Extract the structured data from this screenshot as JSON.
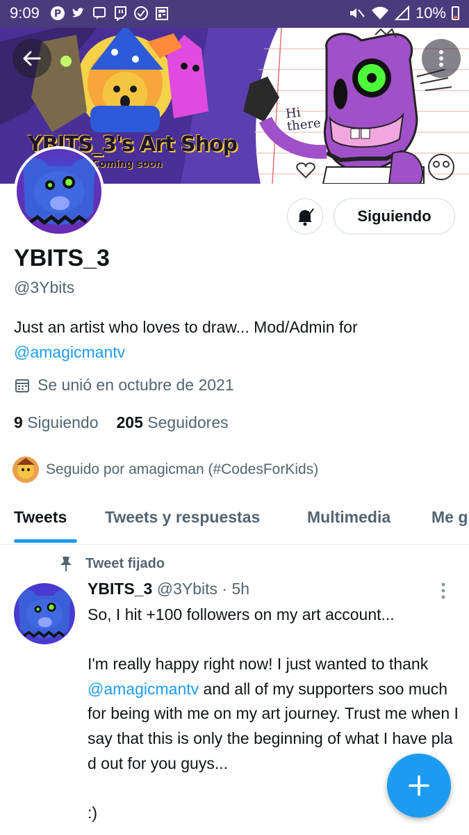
{
  "status_bar": {
    "time": "9:09",
    "battery": "10%"
  },
  "banner": {
    "title": "YBITS_3's Art Shop",
    "subtitle": "Coming soon",
    "speech_text": "Hi\nthere"
  },
  "profile": {
    "name": "YBITS_3",
    "handle": "@3Ybits",
    "bio_text": "Just an artist who loves to draw... Mod/Admin for ",
    "bio_link": "@amagicmantv",
    "joined": "Se unió en octubre de 2021",
    "following_count": "9",
    "following_label": "Siguiendo",
    "followers_count": "205",
    "followers_label": "Seguidores",
    "followed_by": "Seguido por amagicman (#CodesForKids)"
  },
  "buttons": {
    "follow": "Siguiendo"
  },
  "tabs": [
    {
      "label": "Tweets"
    },
    {
      "label": "Tweets y respuestas"
    },
    {
      "label": "Multimedia"
    },
    {
      "label": "Me g"
    }
  ],
  "tweet": {
    "pinned_label": "Tweet fijado",
    "author_name": "YBITS_3",
    "author_handle": "@3Ybits",
    "separator": " · ",
    "time": "5h",
    "body_1": "So, I hit +100 followers on my art account...\n\nI'm really happy right now! I just wanted to thank ",
    "mention": "@amagicmantv",
    "body_2": " and all of my supporters soo much for being with me on my art journey. Trust me when I say that this is only the beginning of what I have pla    d out for you guys...\n\n:)"
  },
  "icons": {
    "back": "arrow-left-icon",
    "more": "more-vertical-icon",
    "bell": "notification-bell-icon",
    "calendar": "calendar-icon",
    "pin": "pin-icon",
    "compose": "plus-icon"
  },
  "colors": {
    "accent": "#1d9bf0",
    "status_bar": "#4a3b7c",
    "text": "#0f1419",
    "secondary_text": "#536471"
  }
}
